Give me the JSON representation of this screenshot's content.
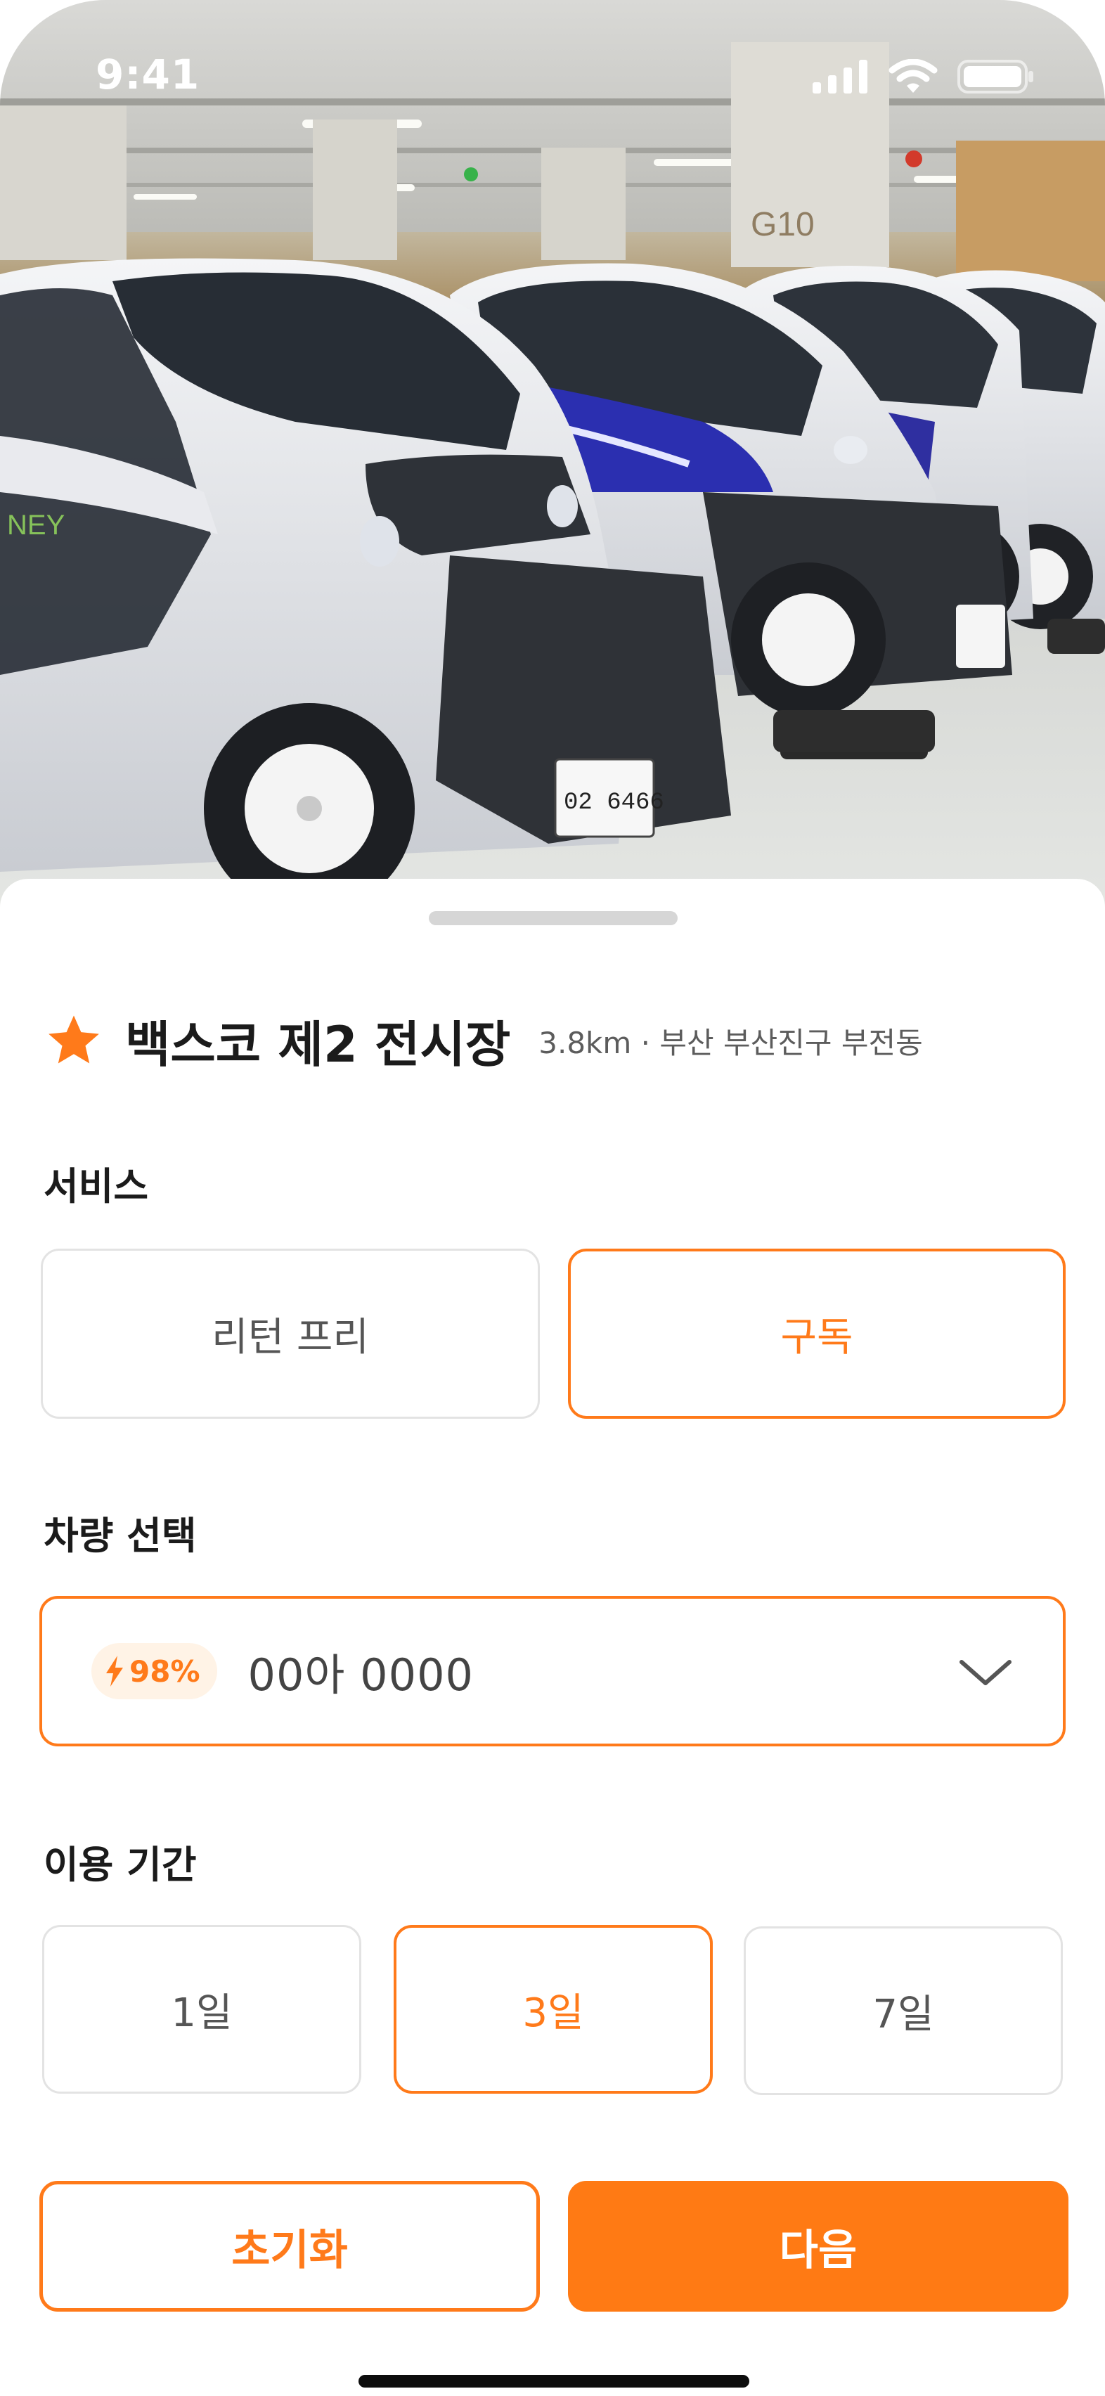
{
  "status_bar": {
    "time": "9:41"
  },
  "station": {
    "name": "백스코 제2 전시장",
    "meta": "3.8km · 부산 부산진구 부전동",
    "favorite_icon": "star-icon"
  },
  "service": {
    "label": "서비스",
    "options": [
      "리턴 프리",
      "구독"
    ],
    "selected": "구독"
  },
  "vehicle": {
    "label": "차량 선택",
    "battery": "98%",
    "plate": "00아 0000",
    "icons": [
      "bolt-icon",
      "chevron-down-icon"
    ]
  },
  "period": {
    "label": "이용 기간",
    "options": [
      "1일",
      "3일",
      "7일"
    ],
    "selected": "3일"
  },
  "actions": {
    "reset_label": "초기화",
    "next_label": "다음"
  },
  "colors": {
    "accent": "#ff7a1a",
    "text_primary": "#1b1b1b",
    "text_secondary": "#555555",
    "border": "#e3e3e3"
  }
}
